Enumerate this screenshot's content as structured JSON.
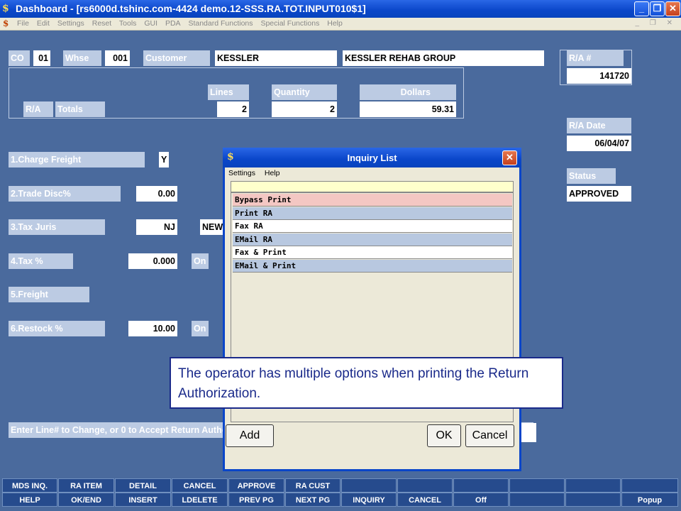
{
  "window": {
    "title": "Dashboard - [rs6000d.tshinc.com-4424 demo.12-SSS.RA.TOT.INPUT010$1]",
    "app_icon": "$",
    "minimize_glyph": "_",
    "maximize_glyph": "❐",
    "close_glyph": "✕"
  },
  "menubar": {
    "items": [
      "File",
      "Edit",
      "Settings",
      "Reset",
      "Tools",
      "GUI",
      "PDA",
      "Standard Functions",
      "Special Functions",
      "Help"
    ],
    "right_controls": "_ ❐ ✕"
  },
  "header": {
    "co_label": "CO",
    "co_value": "01",
    "whse_label": "Whse",
    "whse_value": "001",
    "customer_label": "Customer",
    "customer_code": "KESSLER",
    "customer_name": "KESSLER REHAB GROUP",
    "ra_num_label": "R/A #",
    "ra_num_value": "141720"
  },
  "totals": {
    "lines_label": "Lines",
    "quantity_label": "Quantity",
    "dollars_label": "Dollars",
    "ra_label": "R/A",
    "totals_label": "Totals",
    "lines_value": "2",
    "quantity_value": "2",
    "dollars_value": "59.31"
  },
  "side": {
    "ra_date_label": "R/A Date",
    "ra_date_value": "06/04/07",
    "status_label": "Status",
    "status_value": "APPROVED"
  },
  "fields": {
    "charge_freight_label": "1.Charge Freight",
    "charge_freight_value": "Y",
    "trade_disc_label": "2.Trade Disc%",
    "trade_disc_value": "0.00",
    "tax_juris_label": "3.Tax Juris",
    "tax_juris_value": "NJ",
    "tax_juris_extra": "NEW",
    "tax_pct_label": "4.Tax %",
    "tax_pct_value": "0.000",
    "tax_pct_flag": "On",
    "freight_label": "5.Freight",
    "restock_label": "6.Restock %",
    "restock_value": "10.00",
    "restock_flag": "On"
  },
  "prompt": "Enter Line# to Change, or 0 to Accept Return Autho",
  "dialog": {
    "title": "Inquiry List",
    "menu": [
      "Settings",
      "Help"
    ],
    "items": [
      {
        "label": "Bypass Print",
        "bg": "#f4c7c3"
      },
      {
        "label": "Print RA",
        "bg": "#b8c8e0"
      },
      {
        "label": "Fax RA",
        "bg": "#ffffff"
      },
      {
        "label": "EMail RA",
        "bg": "#b8c8e0"
      },
      {
        "label": "Fax & Print",
        "bg": "#ffffff"
      },
      {
        "label": "EMail & Print",
        "bg": "#b8c8e0"
      }
    ],
    "add_label": "Add",
    "ok_label": "OK",
    "cancel_label": "Cancel"
  },
  "callout": "The operator has multiple options when printing the Return Authorization.",
  "function_keys": {
    "row1": [
      "MDS INQ.",
      "RA ITEM",
      "DETAIL",
      "CANCEL",
      "APPROVE",
      "RA CUST",
      "",
      "",
      "",
      "",
      "",
      ""
    ],
    "row2": [
      "HELP",
      "OK/END",
      "INSERT",
      "LDELETE",
      "PREV PG",
      "NEXT PG",
      "INQUIRY",
      "CANCEL",
      "Off",
      "",
      "",
      "Popup"
    ]
  }
}
